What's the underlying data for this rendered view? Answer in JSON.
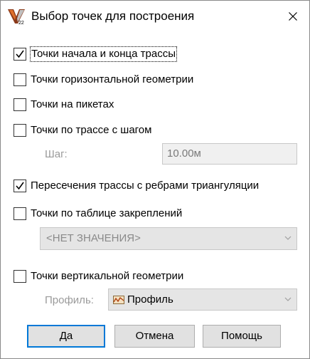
{
  "dialog": {
    "title": "Выбор точек для построения",
    "accent": "#0078d7"
  },
  "options": [
    {
      "label": "Точки начала и конца трассы",
      "checked": true
    },
    {
      "label": "Точки горизонтальной геометрии",
      "checked": false
    },
    {
      "label": "Точки на пикетах",
      "checked": false
    },
    {
      "label": "Точки по трассе с шагом",
      "checked": false
    },
    {
      "label": "Пересечения трассы с ребрами триангуляции",
      "checked": true
    },
    {
      "label": "Точки по таблице закреплений",
      "checked": false
    },
    {
      "label": "Точки вертикальной геометрии",
      "checked": false
    }
  ],
  "step": {
    "label": "Шаг:",
    "value": "10.00м"
  },
  "anchor_table": {
    "selected": "<НЕТ ЗНАЧЕНИЯ>"
  },
  "profile": {
    "label": "Профиль:",
    "selected": "Профиль",
    "icon": "profile-icon"
  },
  "buttons": {
    "ok": "Да",
    "cancel": "Отмена",
    "help": "Помощь"
  }
}
